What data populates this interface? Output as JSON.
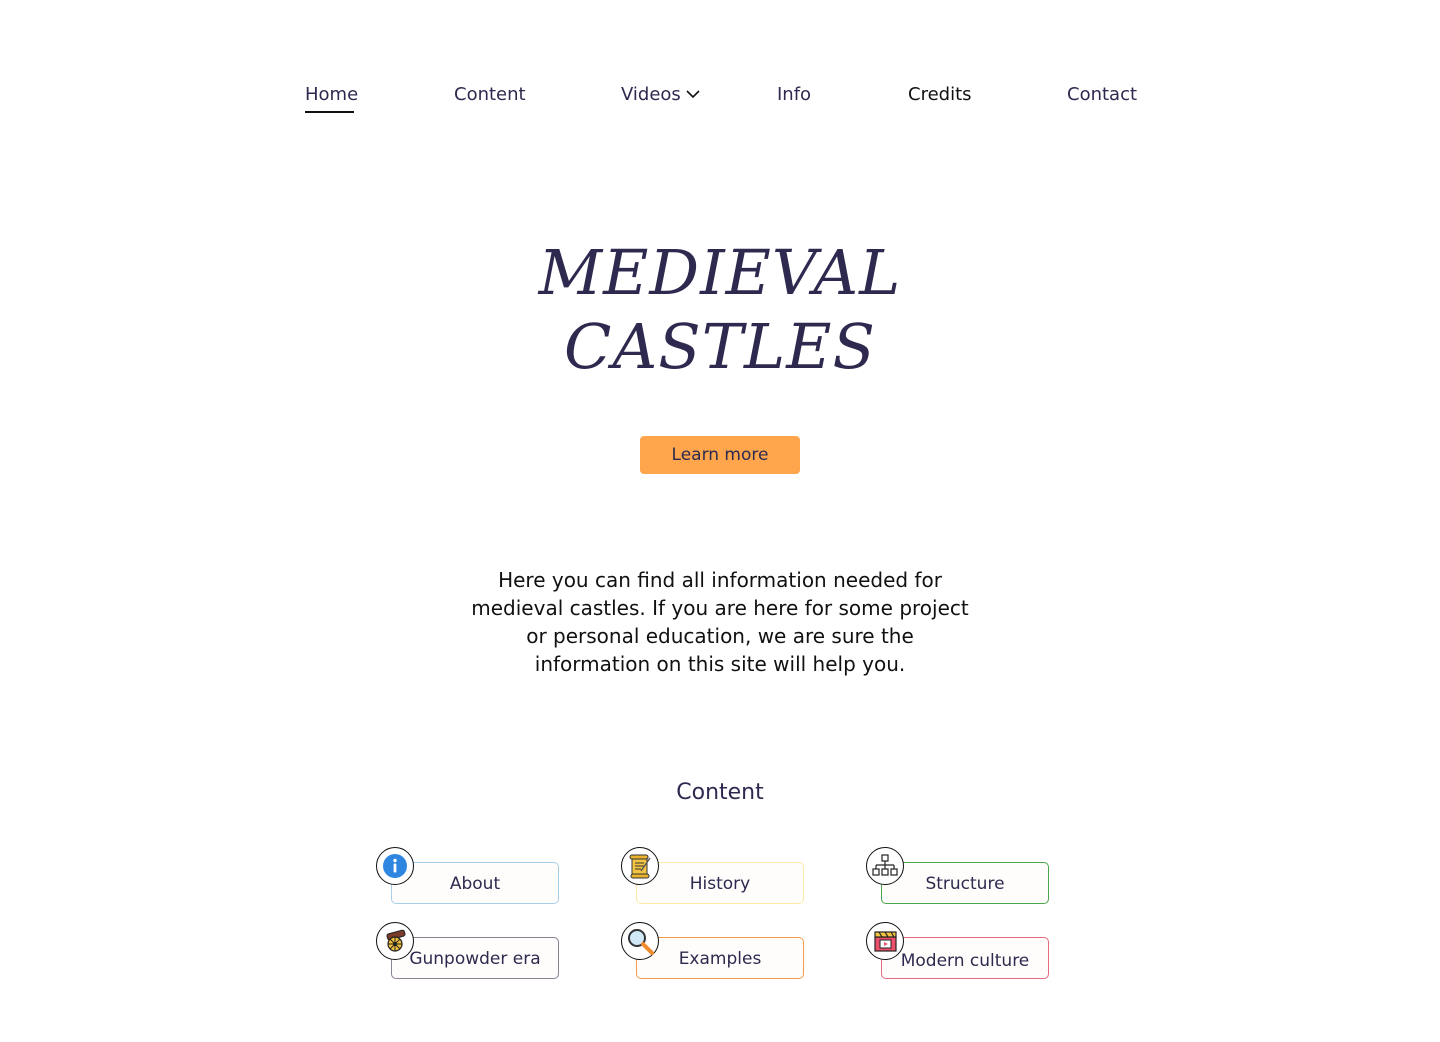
{
  "nav": {
    "items": [
      {
        "label": "Home"
      },
      {
        "label": "Content"
      },
      {
        "label": "Videos"
      },
      {
        "label": "Info"
      },
      {
        "label": "Credits"
      },
      {
        "label": "Contact"
      }
    ],
    "active": "Home"
  },
  "hero": {
    "title_line1": "MEDIEVAL",
    "title_line2": "CASTLES",
    "button_label": "Learn more"
  },
  "intro": {
    "text": "Here you can find all information needed for medieval castles. If you are here for some project or personal education, we are sure the information on this site will help you."
  },
  "content_section": {
    "title": "Content",
    "cards": [
      {
        "label": "About",
        "icon": "info-icon",
        "border": "#a9cfe8"
      },
      {
        "label": "History",
        "icon": "scroll-icon",
        "border": "#fbe9a8"
      },
      {
        "label": "Structure",
        "icon": "hierarchy-icon",
        "border": "#4aa64a"
      },
      {
        "label": "Gunpowder era",
        "icon": "cannon-icon",
        "border": "#8c8296"
      },
      {
        "label": "Examples",
        "icon": "magnifier-icon",
        "border": "#f39a4a"
      },
      {
        "label": "Modern culture",
        "icon": "clapperboard-icon",
        "border": "#e46a7e"
      }
    ]
  },
  "colors": {
    "accent": "#ffa64c",
    "text": "#2e2a4f"
  }
}
